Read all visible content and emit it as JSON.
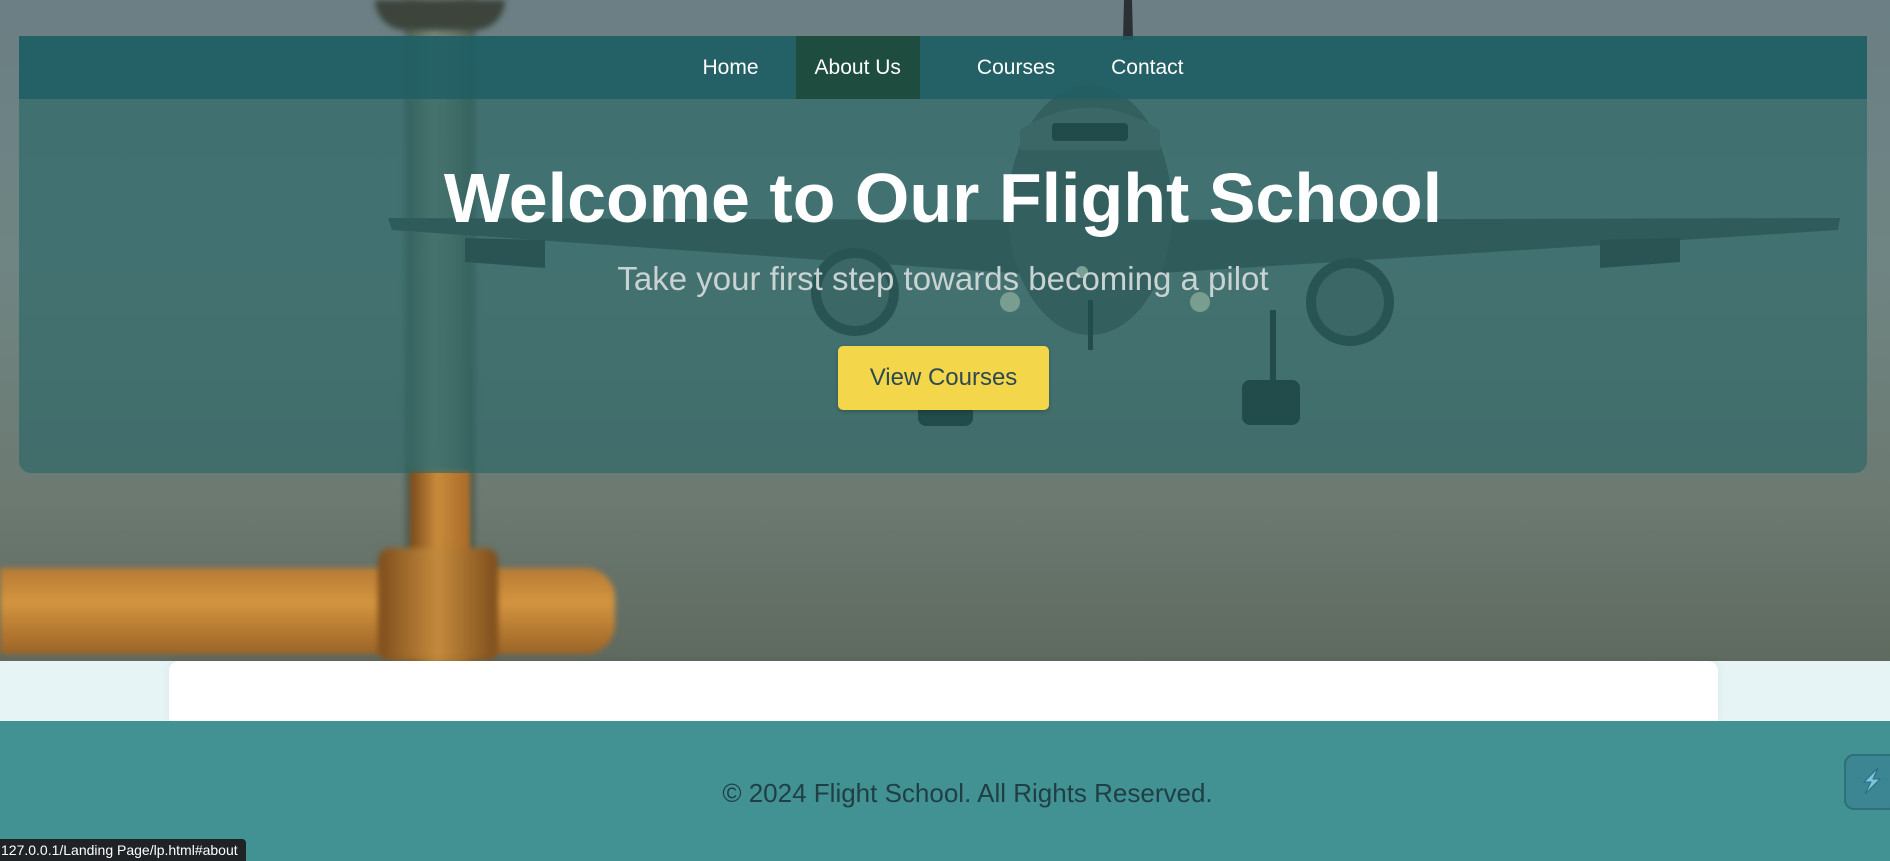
{
  "navbar": {
    "items": [
      {
        "label": "Home"
      },
      {
        "label": "About Us"
      },
      {
        "label": "Courses"
      },
      {
        "label": "Contact"
      }
    ],
    "active_item": "About Us",
    "background": "#1e5e64",
    "active_background": "#1e4d3f"
  },
  "hero": {
    "title": "Welcome to Our Flight School",
    "subtitle": "Take your first step towards becoming a pilot",
    "cta_label": "View Courses",
    "cta_color": "#f4d64a",
    "background_image": "airplane-landing-photo"
  },
  "footer": {
    "text": "© 2024 Flight School. All Rights Reserved.",
    "background": "#429294"
  },
  "widget": {
    "icon": "lightning-bolt-icon"
  },
  "status_bar": {
    "url": "127.0.0.1/Landing Page/lp.html#about"
  }
}
